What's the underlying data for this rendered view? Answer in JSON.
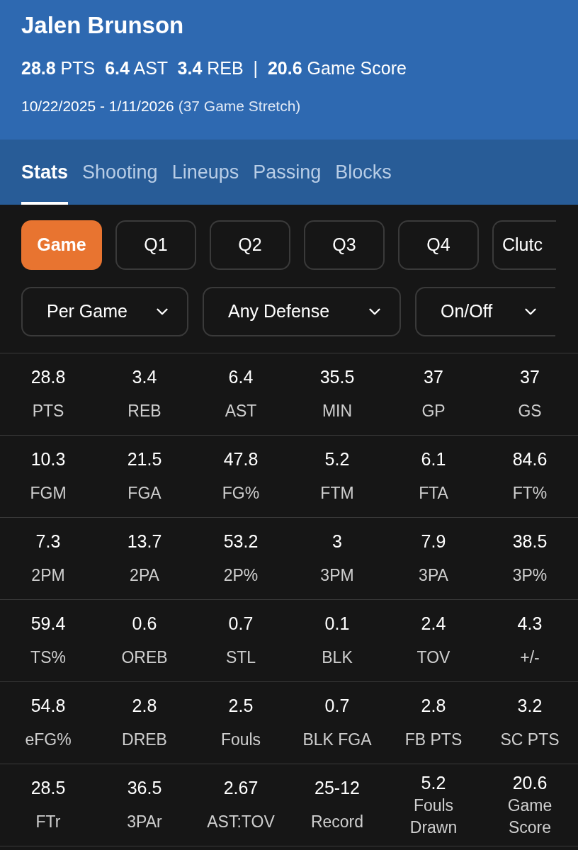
{
  "player": {
    "name": "Jalen Brunson",
    "summary": "**28.8** PTS  **6.4** AST  **3.4** REB  |  **20.6** Game Score",
    "date_range": "10/22/2025 - 1/11/2026",
    "stretch": "(37 Game Stretch)"
  },
  "tabs": [
    {
      "label": "Stats",
      "selected": true
    },
    {
      "label": "Shooting",
      "selected": false
    },
    {
      "label": "Lineups",
      "selected": false
    },
    {
      "label": "Passing",
      "selected": false
    },
    {
      "label": "Blocks",
      "selected": false
    }
  ],
  "periods": [
    {
      "label": "Game",
      "selected": true
    },
    {
      "label": "Q1",
      "selected": false
    },
    {
      "label": "Q2",
      "selected": false
    },
    {
      "label": "Q3",
      "selected": false
    },
    {
      "label": "Q4",
      "selected": false
    },
    {
      "label": "Clutc",
      "selected": false
    }
  ],
  "dropdowns": [
    {
      "value": "Per Game"
    },
    {
      "value": "Any Defense"
    },
    {
      "value": "On/Off"
    }
  ],
  "stats": [
    [
      {
        "value": "28.8",
        "label": "PTS"
      },
      {
        "value": "3.4",
        "label": "REB"
      },
      {
        "value": "6.4",
        "label": "AST"
      },
      {
        "value": "35.5",
        "label": "MIN"
      },
      {
        "value": "37",
        "label": "GP"
      },
      {
        "value": "37",
        "label": "GS"
      }
    ],
    [
      {
        "value": "10.3",
        "label": "FGM"
      },
      {
        "value": "21.5",
        "label": "FGA"
      },
      {
        "value": "47.8",
        "label": "FG%"
      },
      {
        "value": "5.2",
        "label": "FTM"
      },
      {
        "value": "6.1",
        "label": "FTA"
      },
      {
        "value": "84.6",
        "label": "FT%"
      }
    ],
    [
      {
        "value": "7.3",
        "label": "2PM"
      },
      {
        "value": "13.7",
        "label": "2PA"
      },
      {
        "value": "53.2",
        "label": "2P%"
      },
      {
        "value": "3",
        "label": "3PM"
      },
      {
        "value": "7.9",
        "label": "3PA"
      },
      {
        "value": "38.5",
        "label": "3P%"
      }
    ],
    [
      {
        "value": "59.4",
        "label": "TS%"
      },
      {
        "value": "0.6",
        "label": "OREB"
      },
      {
        "value": "0.7",
        "label": "STL"
      },
      {
        "value": "0.1",
        "label": "BLK"
      },
      {
        "value": "2.4",
        "label": "TOV"
      },
      {
        "value": "4.3",
        "label": "+/-"
      }
    ],
    [
      {
        "value": "54.8",
        "label": "eFG%"
      },
      {
        "value": "2.8",
        "label": "DREB"
      },
      {
        "value": "2.5",
        "label": "Fouls"
      },
      {
        "value": "0.7",
        "label": "BLK FGA"
      },
      {
        "value": "2.8",
        "label": "FB PTS"
      },
      {
        "value": "3.2",
        "label": "SC PTS"
      }
    ],
    [
      {
        "value": "28.5",
        "label": "FTr"
      },
      {
        "value": "36.5",
        "label": "3PAr"
      },
      {
        "value": "2.67",
        "label": "AST:TOV"
      },
      {
        "value": "25-12",
        "label": "Record"
      },
      {
        "value": "5.2",
        "label": "Fouls Drawn"
      },
      {
        "value": "20.6",
        "label": "Game Score"
      }
    ]
  ]
}
